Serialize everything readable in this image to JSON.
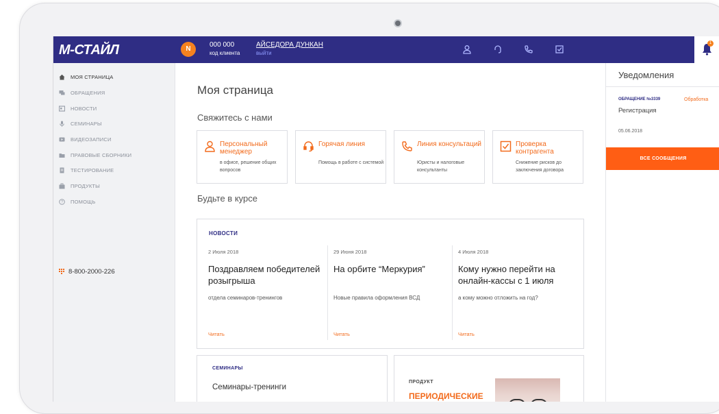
{
  "header": {
    "logo": "М-СТАЙЛ",
    "avatar_letter": "N",
    "client_number": "000 000",
    "client_label": "код клиента",
    "user_name": "АЙСЕДОРА ДУНКАН",
    "logout_label": "выйти",
    "icons": [
      "person-icon",
      "headset-icon",
      "phone-icon",
      "checkbox-icon"
    ],
    "notification_count": "1"
  },
  "sidebar": {
    "items": [
      {
        "label": "МОЯ СТРАНИЦА",
        "icon": "home-icon"
      },
      {
        "label": "ОБРАЩЕНИЯ",
        "icon": "chat-icon"
      },
      {
        "label": "НОВОСТИ",
        "icon": "newspaper-icon"
      },
      {
        "label": "СЕМИНАРЫ",
        "icon": "microphone-icon"
      },
      {
        "label": "ВИДЕОЗАПИСИ",
        "icon": "video-icon"
      },
      {
        "label": "ПРАВОВЫЕ СБОРНИКИ",
        "icon": "folder-icon"
      },
      {
        "label": "ТЕСТИРОВАНИЕ",
        "icon": "document-icon"
      },
      {
        "label": "ПРОДУКТЫ",
        "icon": "briefcase-icon"
      },
      {
        "label": "ПОМОЩЬ",
        "icon": "help-icon"
      }
    ],
    "phone": "8-800-2000-226"
  },
  "main": {
    "page_title": "Моя страница",
    "contact_title": "Свяжитесь с нами",
    "contact_cards": [
      {
        "title": "Персональный менеджер",
        "subtitle": "в офисе, решение общих вопросов",
        "icon": "person-icon"
      },
      {
        "title": "Горячая линия",
        "subtitle": "Помощь в работе с системой",
        "icon": "headset-icon"
      },
      {
        "title": "Линия консультаций",
        "subtitle": "Юристы и налоговые консультанты",
        "icon": "phone-icon"
      },
      {
        "title": "Проверка контрагента",
        "subtitle": "Снижение рисков до заключения договора",
        "icon": "checkbox-icon"
      }
    ],
    "updates_title": "Будьте в курсе",
    "news": {
      "label": "НОВОСТИ",
      "items": [
        {
          "date": "2 Июля 2018",
          "title": "Поздравляем победителей розыгрыша",
          "desc": "отдела семинаров-тренингов",
          "read": "Читать"
        },
        {
          "date": "29 Июня 2018",
          "title": "На орбите “Меркурия”",
          "desc": "Новые правила оформления ВСД",
          "read": "Читать"
        },
        {
          "date": "4 Июля 2018",
          "title": "Кому нужно перейти на онлайн-кассы с 1 июля",
          "desc": "а кому можно отложить на год?",
          "read": "Читать"
        }
      ]
    },
    "seminars": {
      "label": "СЕМИНАРЫ",
      "title": "Семинары-тренинги"
    },
    "product": {
      "label": "ПРОДУКТ",
      "title": "ПЕРИОДИЧЕСКИЕ"
    }
  },
  "notifications": {
    "title": "Уведомления",
    "ticket": "ОБРАЩЕНИЕ №3339",
    "status": "Обработка",
    "type": "Регистрация",
    "date": "05.06.2018",
    "all_button": "ВСЕ СООБЩЕНИЯ"
  },
  "colors": {
    "brand": "#2f2d84",
    "accent": "#f26a1b",
    "button": "#ff5e14"
  }
}
